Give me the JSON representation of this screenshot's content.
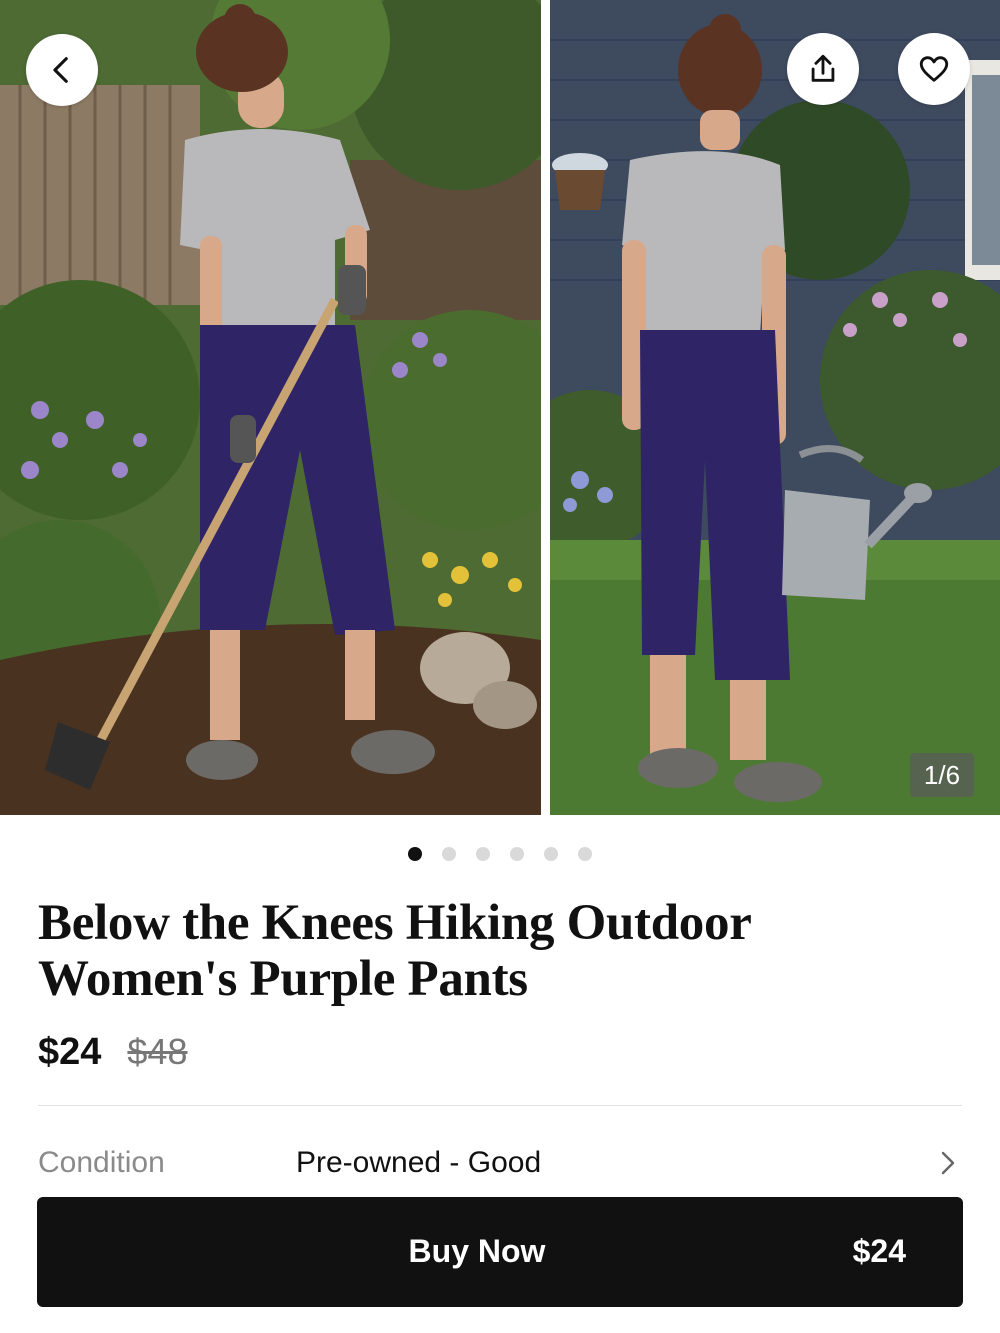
{
  "gallery": {
    "counter": "1/6",
    "image_count": 6,
    "active_index": 0,
    "left_image": "woman gardening with hoe, purple capri pants",
    "right_image": "woman from behind holding watering can, purple capri pants"
  },
  "icons": {
    "back": "chevron-left-icon",
    "share": "share-icon",
    "favorite": "heart-icon",
    "condition_arrow": "chevron-right-icon"
  },
  "product": {
    "title": "Below the Knees Hiking Outdoor Women's Purple Pants",
    "price": "$24",
    "original_price": "$48"
  },
  "details": {
    "condition_label": "Condition",
    "condition_value": "Pre-owned - Good"
  },
  "cta": {
    "label": "Buy Now",
    "price": "$24"
  },
  "colors": {
    "button_bg": "#111111",
    "pants": "#2e2466",
    "active_dot": "#111111",
    "inactive_dot": "#d9d9d9"
  }
}
